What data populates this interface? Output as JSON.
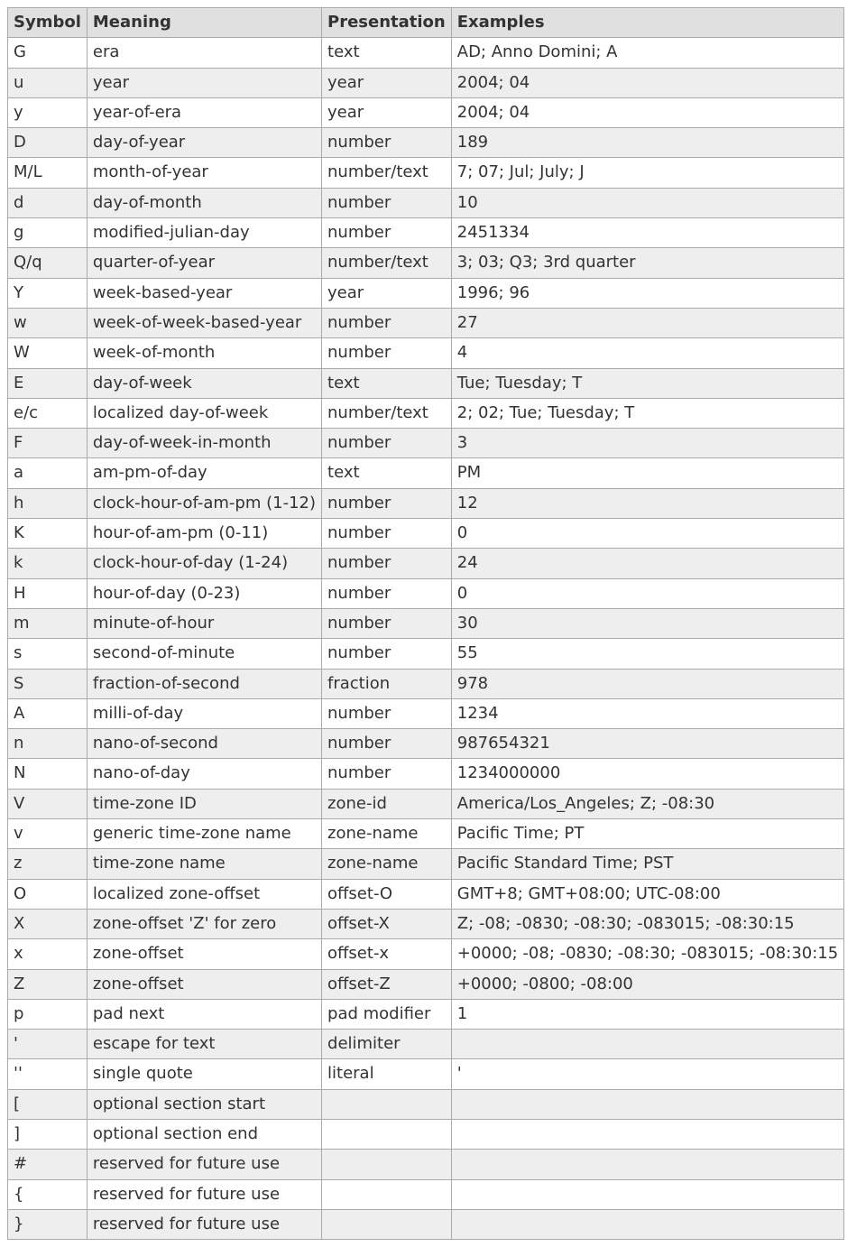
{
  "table": {
    "headers": [
      "Symbol",
      "Meaning",
      "Presentation",
      "Examples"
    ],
    "rows": [
      {
        "symbol": "G",
        "meaning": "era",
        "presentation": "text",
        "examples": "AD; Anno Domini; A"
      },
      {
        "symbol": "u",
        "meaning": "year",
        "presentation": "year",
        "examples": "2004; 04"
      },
      {
        "symbol": "y",
        "meaning": "year-of-era",
        "presentation": "year",
        "examples": "2004; 04"
      },
      {
        "symbol": "D",
        "meaning": "day-of-year",
        "presentation": "number",
        "examples": "189"
      },
      {
        "symbol": "M/L",
        "meaning": "month-of-year",
        "presentation": "number/text",
        "examples": "7; 07; Jul; July; J"
      },
      {
        "symbol": "d",
        "meaning": "day-of-month",
        "presentation": "number",
        "examples": "10"
      },
      {
        "symbol": "g",
        "meaning": "modified-julian-day",
        "presentation": "number",
        "examples": "2451334"
      },
      {
        "symbol": "Q/q",
        "meaning": "quarter-of-year",
        "presentation": "number/text",
        "examples": "3; 03; Q3; 3rd quarter"
      },
      {
        "symbol": "Y",
        "meaning": "week-based-year",
        "presentation": "year",
        "examples": "1996; 96"
      },
      {
        "symbol": "w",
        "meaning": "week-of-week-based-year",
        "presentation": "number",
        "examples": "27"
      },
      {
        "symbol": "W",
        "meaning": "week-of-month",
        "presentation": "number",
        "examples": "4"
      },
      {
        "symbol": "E",
        "meaning": "day-of-week",
        "presentation": "text",
        "examples": "Tue; Tuesday; T"
      },
      {
        "symbol": "e/c",
        "meaning": "localized day-of-week",
        "presentation": "number/text",
        "examples": "2; 02; Tue; Tuesday; T"
      },
      {
        "symbol": "F",
        "meaning": "day-of-week-in-month",
        "presentation": "number",
        "examples": "3"
      },
      {
        "symbol": "a",
        "meaning": "am-pm-of-day",
        "presentation": "text",
        "examples": "PM"
      },
      {
        "symbol": "h",
        "meaning": "clock-hour-of-am-pm (1-12)",
        "presentation": "number",
        "examples": "12"
      },
      {
        "symbol": "K",
        "meaning": "hour-of-am-pm (0-11)",
        "presentation": "number",
        "examples": "0"
      },
      {
        "symbol": "k",
        "meaning": "clock-hour-of-day (1-24)",
        "presentation": "number",
        "examples": "24"
      },
      {
        "symbol": "H",
        "meaning": "hour-of-day (0-23)",
        "presentation": "number",
        "examples": "0"
      },
      {
        "symbol": "m",
        "meaning": "minute-of-hour",
        "presentation": "number",
        "examples": "30"
      },
      {
        "symbol": "s",
        "meaning": "second-of-minute",
        "presentation": "number",
        "examples": "55"
      },
      {
        "symbol": "S",
        "meaning": "fraction-of-second",
        "presentation": "fraction",
        "examples": "978"
      },
      {
        "symbol": "A",
        "meaning": "milli-of-day",
        "presentation": "number",
        "examples": "1234"
      },
      {
        "symbol": "n",
        "meaning": "nano-of-second",
        "presentation": "number",
        "examples": "987654321"
      },
      {
        "symbol": "N",
        "meaning": "nano-of-day",
        "presentation": "number",
        "examples": "1234000000"
      },
      {
        "symbol": "V",
        "meaning": "time-zone ID",
        "presentation": "zone-id",
        "examples": "America/Los_Angeles; Z; -08:30"
      },
      {
        "symbol": "v",
        "meaning": "generic time-zone name",
        "presentation": "zone-name",
        "examples": "Pacific Time; PT"
      },
      {
        "symbol": "z",
        "meaning": "time-zone name",
        "presentation": "zone-name",
        "examples": "Pacific Standard Time; PST"
      },
      {
        "symbol": "O",
        "meaning": "localized zone-offset",
        "presentation": "offset-O",
        "examples": "GMT+8; GMT+08:00; UTC-08:00"
      },
      {
        "symbol": "X",
        "meaning": "zone-offset 'Z' for zero",
        "presentation": "offset-X",
        "examples": "Z; -08; -0830; -08:30; -083015; -08:30:15"
      },
      {
        "symbol": "x",
        "meaning": "zone-offset",
        "presentation": "offset-x",
        "examples": "+0000; -08; -0830; -08:30; -083015; -08:30:15"
      },
      {
        "symbol": "Z",
        "meaning": "zone-offset",
        "presentation": "offset-Z",
        "examples": "+0000; -0800; -08:00"
      },
      {
        "symbol": "p",
        "meaning": "pad next",
        "presentation": "pad modifier",
        "examples": "1"
      },
      {
        "symbol": "'",
        "meaning": "escape for text",
        "presentation": "delimiter",
        "examples": ""
      },
      {
        "symbol": "''",
        "meaning": "single quote",
        "presentation": "literal",
        "examples": "'"
      },
      {
        "symbol": "[",
        "meaning": "optional section start",
        "presentation": "",
        "examples": ""
      },
      {
        "symbol": "]",
        "meaning": "optional section end",
        "presentation": "",
        "examples": ""
      },
      {
        "symbol": "#",
        "meaning": "reserved for future use",
        "presentation": "",
        "examples": ""
      },
      {
        "symbol": "{",
        "meaning": "reserved for future use",
        "presentation": "",
        "examples": ""
      },
      {
        "symbol": "}",
        "meaning": "reserved for future use",
        "presentation": "",
        "examples": ""
      }
    ]
  }
}
